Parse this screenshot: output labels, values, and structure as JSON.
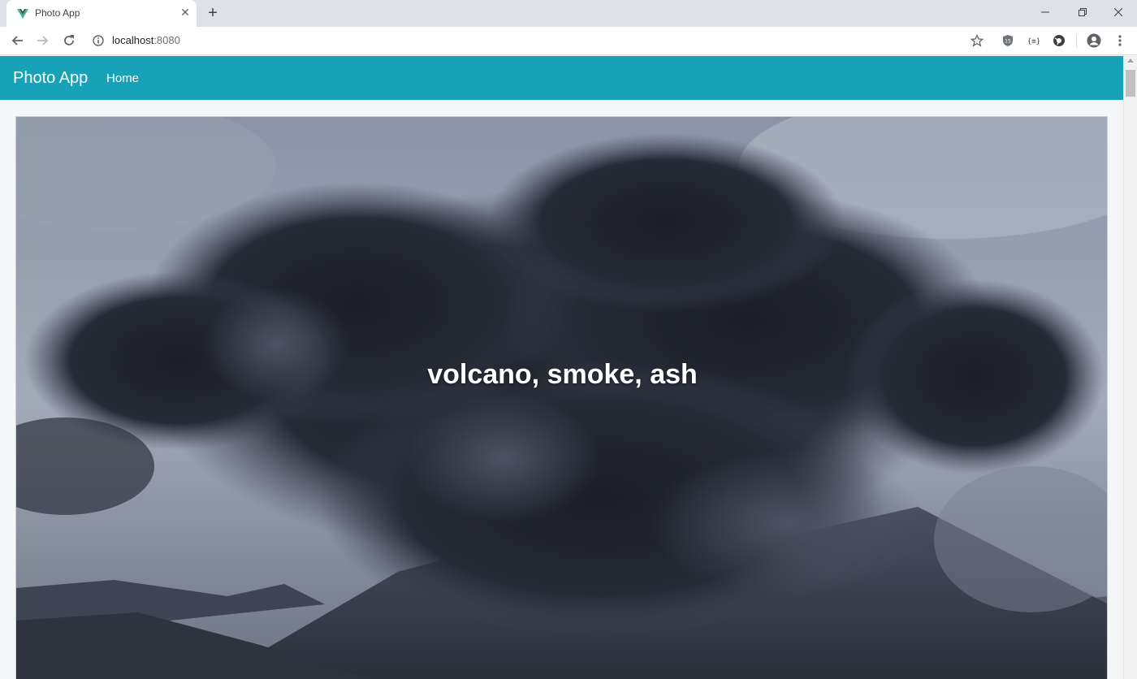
{
  "browser": {
    "tab_title": "Photo App",
    "tab_close": "✕",
    "new_tab": "+",
    "address": {
      "host": "localhost",
      "port": ":8080"
    },
    "window_controls": {
      "minimize": "—",
      "restore": "❐",
      "close": "✕"
    }
  },
  "navbar": {
    "brand": "Photo App",
    "links": [
      {
        "label": "Home"
      }
    ],
    "color": "#17a2b8"
  },
  "photo": {
    "caption": "volcano, smoke, ash",
    "subject": "volcano erupting with a large dark ash cloud"
  },
  "icons": [
    "vue-logo-icon",
    "close-icon",
    "plus-icon",
    "back-arrow-icon",
    "forward-arrow-icon",
    "reload-icon",
    "info-icon",
    "star-icon",
    "ublock-shield-icon",
    "json-extension-icon",
    "extension-icon",
    "profile-icon",
    "kebab-menu-icon"
  ]
}
